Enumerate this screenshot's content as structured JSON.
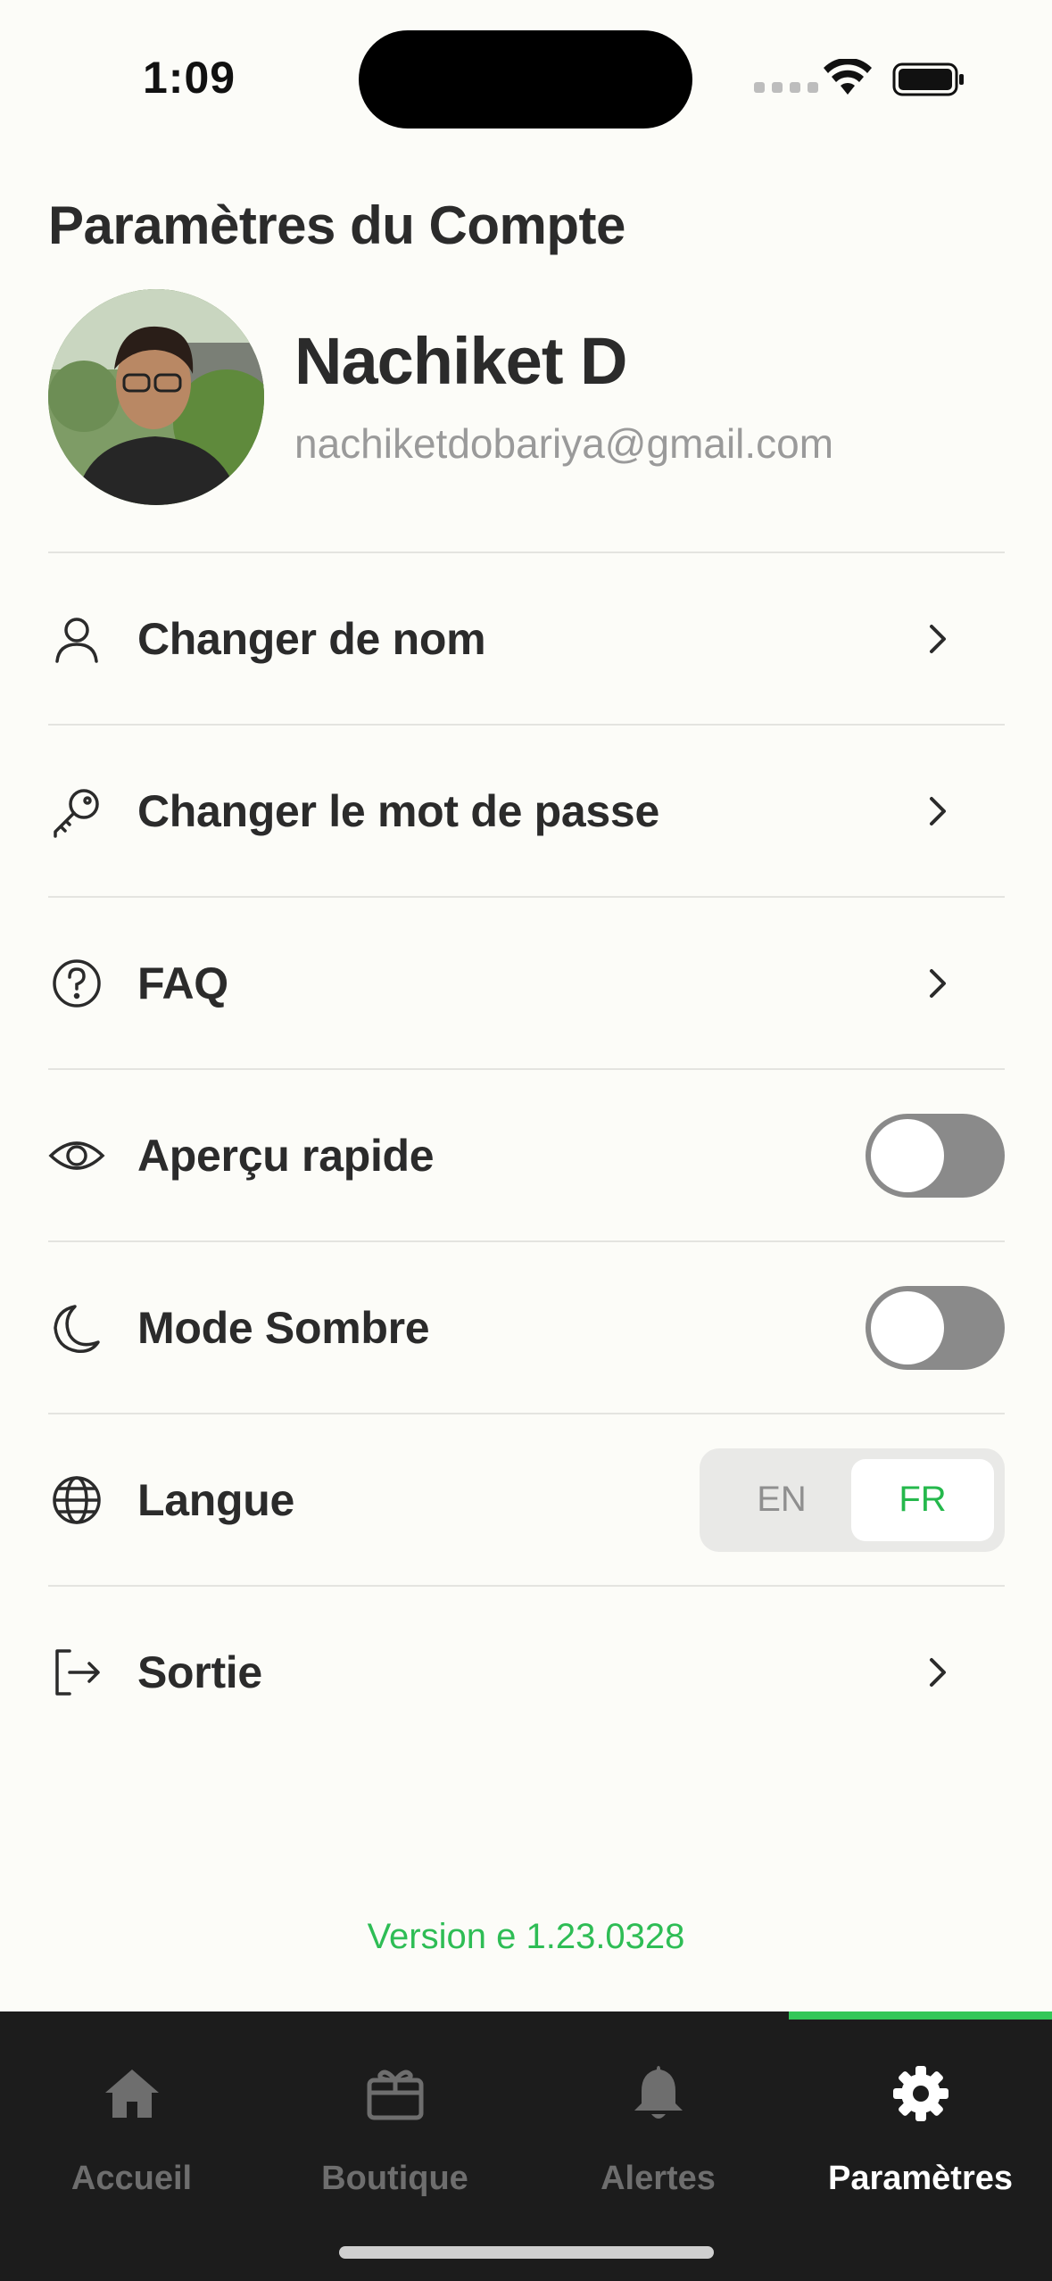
{
  "status_bar": {
    "time": "1:09"
  },
  "header": {
    "title": "Paramètres du Compte"
  },
  "profile": {
    "name": "Nachiket D",
    "email": "nachiketdobariya@gmail.com"
  },
  "menu": {
    "items": [
      {
        "label": "Changer de nom",
        "icon": "user-icon",
        "control": "chevron"
      },
      {
        "label": "Changer le mot de passe",
        "icon": "key-icon",
        "control": "chevron"
      },
      {
        "label": "FAQ",
        "icon": "help-circle-icon",
        "control": "chevron"
      },
      {
        "label": "Aperçu rapide",
        "icon": "eye-icon",
        "control": "toggle",
        "on": false
      },
      {
        "label": "Mode Sombre",
        "icon": "moon-icon",
        "control": "toggle",
        "on": false
      },
      {
        "label": "Langue",
        "icon": "globe-icon",
        "control": "segmented"
      },
      {
        "label": "Sortie",
        "icon": "logout-icon",
        "control": "chevron"
      }
    ],
    "language": {
      "options": [
        "EN",
        "FR"
      ],
      "selected": "FR"
    }
  },
  "version": "Version e 1.23.0328",
  "tabbar": {
    "tabs": [
      {
        "label": "Accueil",
        "icon": "home-icon"
      },
      {
        "label": "Boutique",
        "icon": "shop-icon"
      },
      {
        "label": "Alertes",
        "icon": "bell-icon"
      },
      {
        "label": "Paramètres",
        "icon": "gear-icon",
        "active": true
      }
    ]
  },
  "colors": {
    "accent": "#2ebd55",
    "tabbar_bg": "#1c1c1c",
    "background": "#FCFCF8"
  }
}
